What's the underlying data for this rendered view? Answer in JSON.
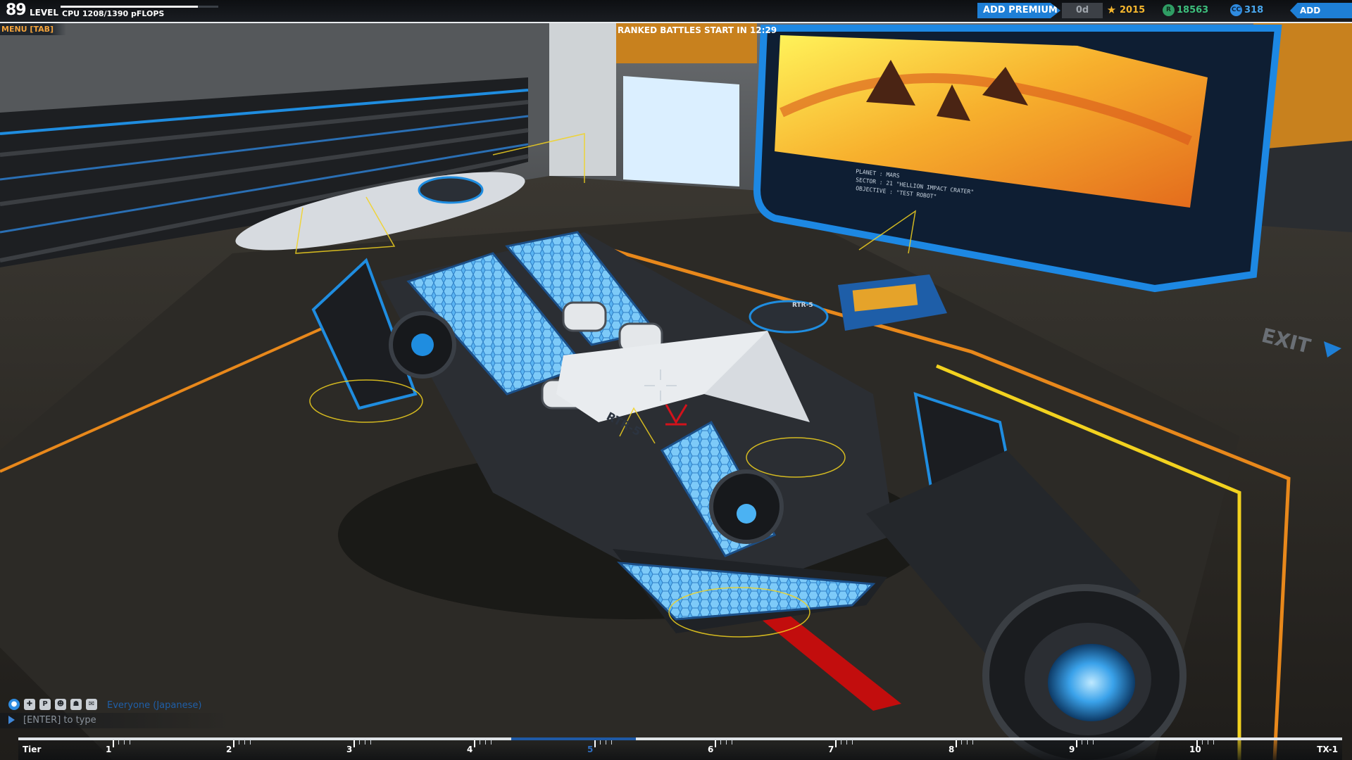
{
  "hud": {
    "level_number": "89",
    "level_label": "LEVEL",
    "cpu_text": "CPU 1208/1390 pFLOPS",
    "cpu_fraction": 0.869,
    "menu_label": "MENU [TAB]",
    "ranked_text": "RANKED BATTLES START IN 12:29",
    "exit_label": "EXIT"
  },
  "wallet": {
    "add_premium": "ADD PREMIUM",
    "premium_days": "0d",
    "tech_points": "2015",
    "robits": "18563",
    "cosmetic_credits": "318",
    "add_funds": "ADD FUNDS",
    "tech_icon": "star-icon",
    "robits_icon": "robits-coin-icon",
    "cc_icon": "cosmetic-credit-icon"
  },
  "screen_panel": {
    "line1": "PLANET : MARS",
    "line2": "SECTOR : 21 \"HELLION IMPACT CRATER\"",
    "line3": "OBJECTIVE : \"TEST ROBOT\""
  },
  "robot": {
    "rotor_label_1": "RTR-5",
    "rotor_label_2": "RTR-5"
  },
  "chat": {
    "channel": "Everyone (Japanese)",
    "hint": "[ENTER] to type",
    "icons": [
      "globe-icon",
      "team-icon",
      "party-icon",
      "friend-icon",
      "clan-icon",
      "whisper-icon"
    ],
    "party_glyph": "P"
  },
  "tiers": {
    "start_label": "Tier",
    "labels": [
      "1",
      "2",
      "3",
      "4",
      "5",
      "6",
      "7",
      "8",
      "9",
      "10"
    ],
    "end_label": "TX-1",
    "current_tier": "5"
  },
  "colors": {
    "accent_blue": "#1e7fd6",
    "tech_gold": "#f5b62e",
    "robits_green": "#3dbf7c",
    "cc_blue": "#49a7ee",
    "menu_orange": "#f3a33b",
    "floor_orange": "#e8881b",
    "hologram_yellow": "#f2d21f"
  }
}
